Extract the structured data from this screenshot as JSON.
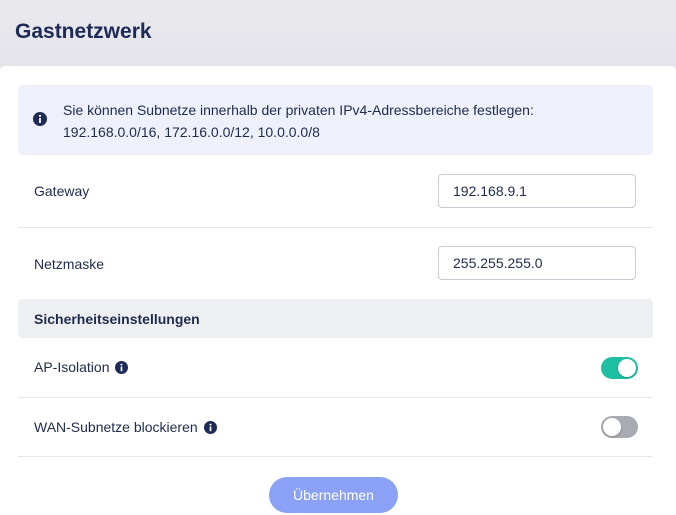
{
  "page": {
    "title": "Gastnetzwerk"
  },
  "info": {
    "icon": "info-circle-icon",
    "line1": "Sie können Subnetze innerhalb der privaten IPv4-Adressbereiche festlegen:",
    "line2": "192.168.0.0/16, 172.16.0.0/12, 10.0.0.0/8"
  },
  "gateway": {
    "label": "Gateway",
    "value": "192.168.9.1"
  },
  "netmask": {
    "label": "Netzmaske",
    "value": "255.255.255.0"
  },
  "security": {
    "title": "Sicherheitseinstellungen",
    "ap_isolation": {
      "label": "AP-Isolation",
      "enabled": true,
      "icon": "info-circle-icon"
    },
    "wan_block": {
      "label": "WAN-Subnetze blockieren",
      "enabled": false,
      "icon": "info-circle-icon"
    }
  },
  "apply": {
    "label": "Übernehmen"
  },
  "colors": {
    "accent": "#1fbfa3",
    "toggle_off": "#a9abb2",
    "button": "#8aa1f6",
    "heading": "#1c2a55",
    "icon": "#1c2a55"
  }
}
